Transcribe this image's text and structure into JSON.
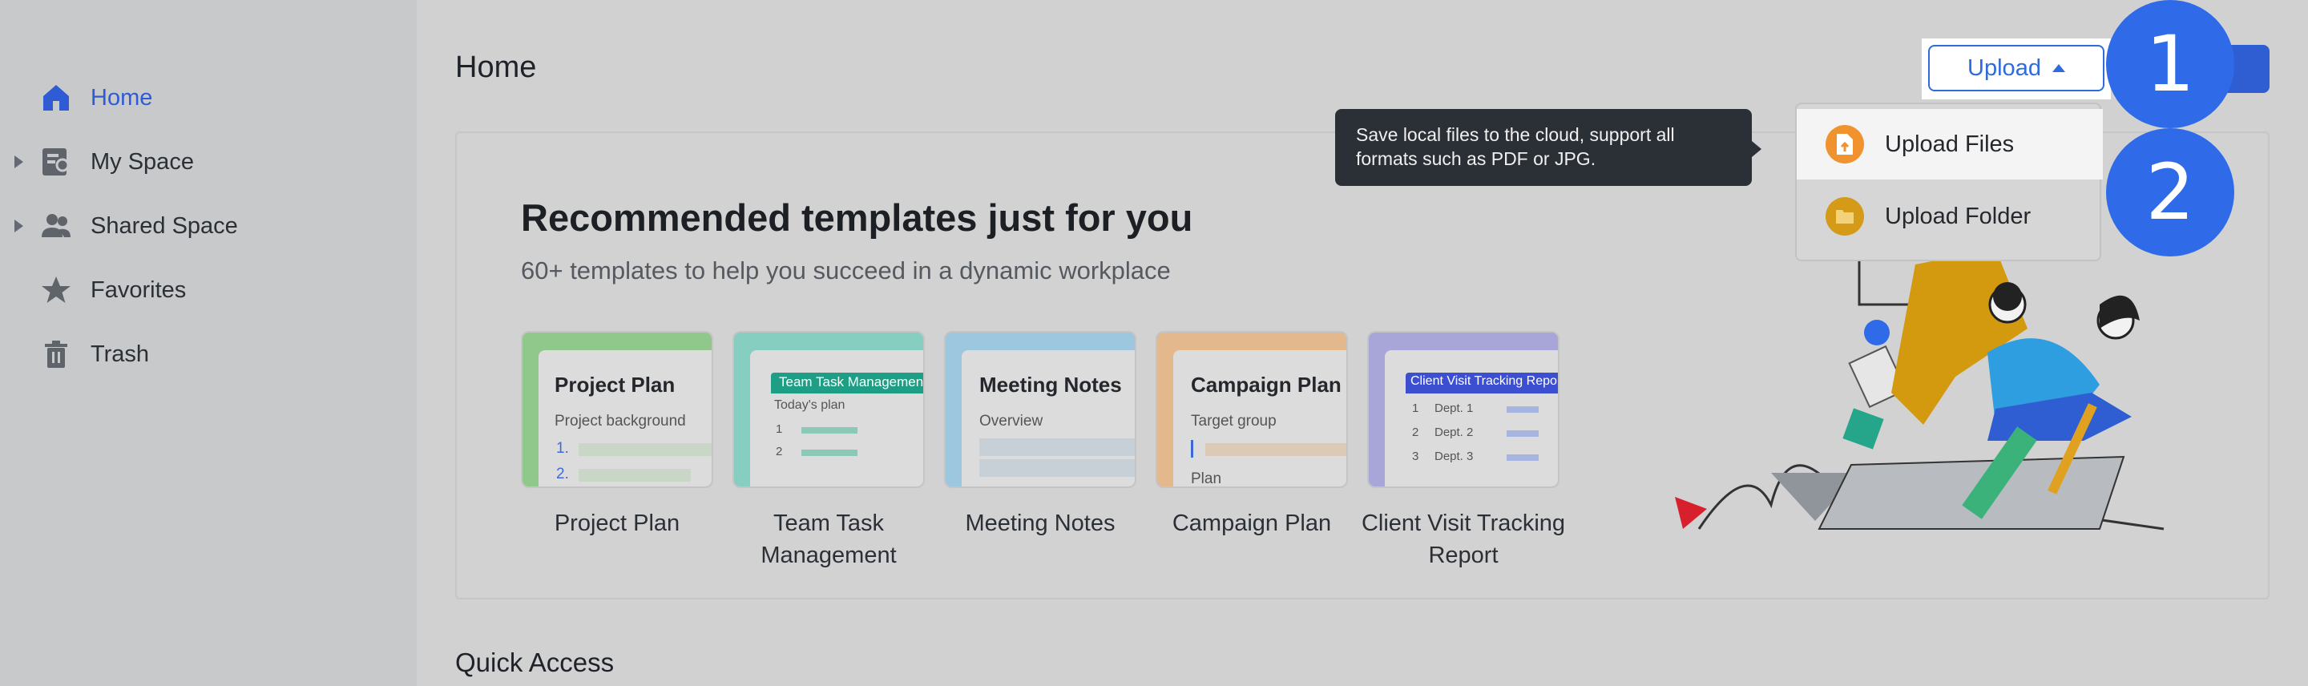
{
  "sidebar": {
    "items": [
      {
        "label": "Home",
        "icon": "home-icon",
        "active": true
      },
      {
        "label": "My Space",
        "icon": "my-space-icon",
        "expandable": true
      },
      {
        "label": "Shared Space",
        "icon": "shared-space-icon",
        "expandable": true
      },
      {
        "label": "Favorites",
        "icon": "star-icon"
      },
      {
        "label": "Trash",
        "icon": "trash-icon"
      }
    ]
  },
  "header": {
    "title": "Home",
    "upload_label": "Upload"
  },
  "tooltip": {
    "text": "Save local files to the cloud, support all formats such as PDF or JPG."
  },
  "upload_menu": {
    "items": [
      {
        "label": "Upload Files",
        "icon": "file-upload-icon"
      },
      {
        "label": "Upload Folder",
        "icon": "folder-icon"
      }
    ]
  },
  "badges": [
    "1",
    "2"
  ],
  "recommend": {
    "title": "Recommended templates just for you",
    "subtitle": "60+ templates to help you succeed in a dynamic workplace",
    "templates": [
      {
        "caption": "Project Plan",
        "card_title": "Project Plan",
        "card_sub": "Project background",
        "card_list": [
          "1.",
          "2."
        ],
        "color": "#8fc88a"
      },
      {
        "caption": "Team Task Management",
        "card_title": "Team Task Management",
        "card_sub": "Today's plan",
        "card_list": [
          "1",
          "2"
        ],
        "color": "#86cfc0"
      },
      {
        "caption": "Meeting Notes",
        "card_title": "Meeting Notes",
        "card_sub": "Overview",
        "color": "#9cc7de"
      },
      {
        "caption": "Campaign Plan",
        "card_title": "Campaign Plan",
        "card_sub": "Target group",
        "card_extra": "Plan",
        "color": "#e2b88c"
      },
      {
        "caption": "Client Visit Tracking Report",
        "card_title": "Client Visit Tracking Report",
        "card_rows": [
          "1",
          "2",
          "3"
        ],
        "card_depts": [
          "Dept. 1",
          "Dept. 2",
          "Dept. 3"
        ],
        "color": "#a8a6d8"
      }
    ]
  },
  "quick_access": {
    "title": "Quick Access"
  },
  "colors": {
    "accent": "#2f6bdb",
    "badge": "#2f6be8",
    "tooltip_bg": "#2b2f36"
  }
}
